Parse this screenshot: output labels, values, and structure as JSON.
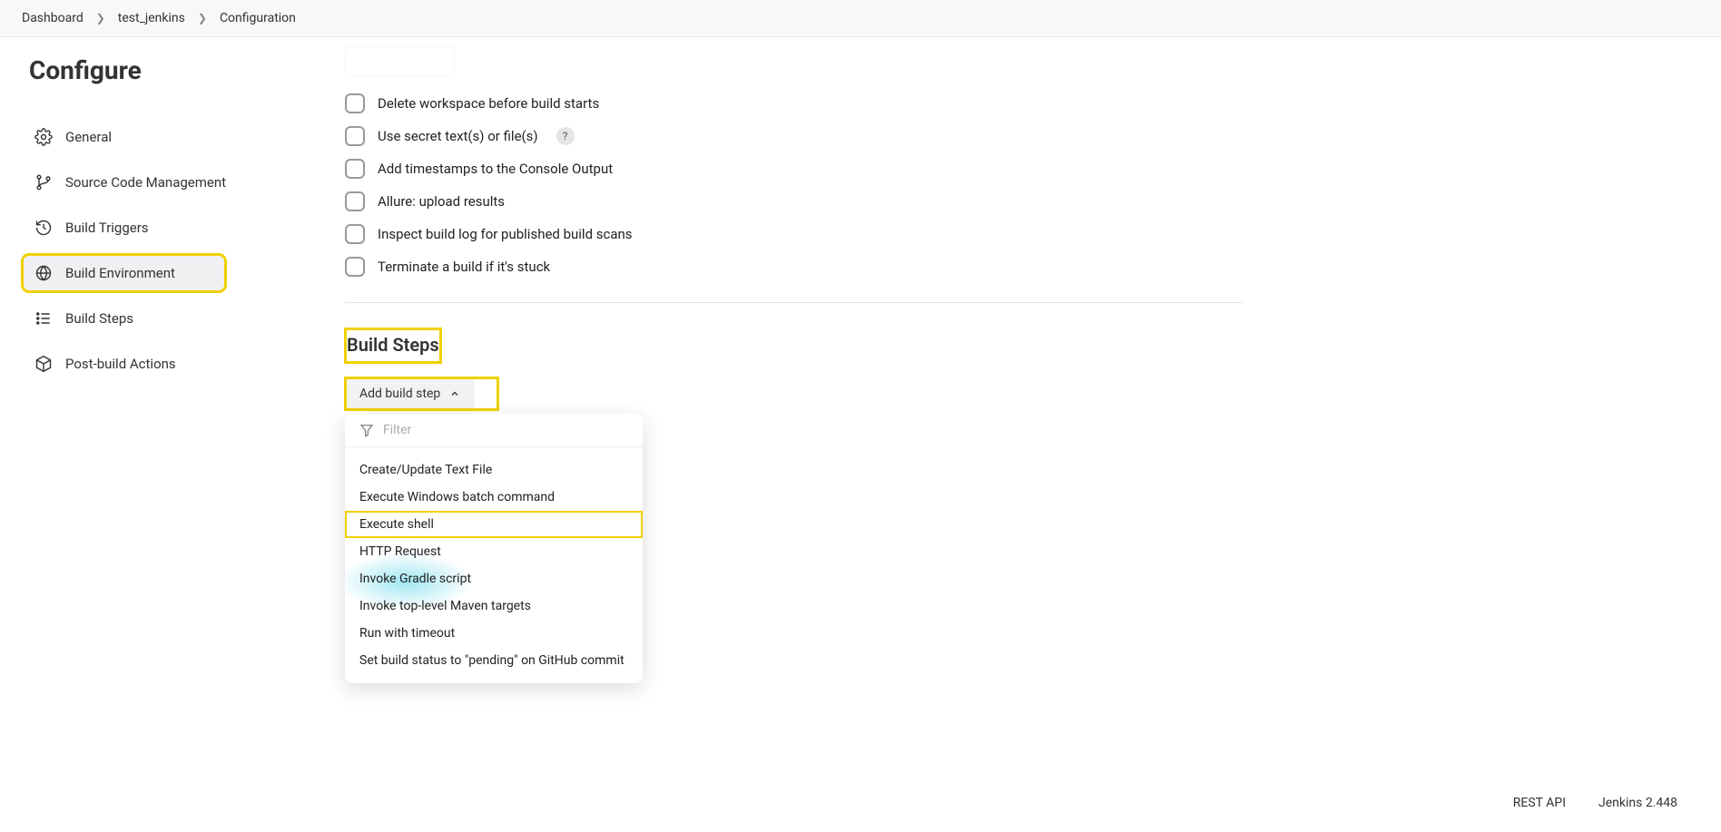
{
  "breadcrumb": {
    "items": [
      "Dashboard",
      "test_jenkins",
      "Configuration"
    ]
  },
  "sidebar": {
    "title": "Configure",
    "items": [
      {
        "label": "General"
      },
      {
        "label": "Source Code Management"
      },
      {
        "label": "Build Triggers"
      },
      {
        "label": "Build Environment"
      },
      {
        "label": "Build Steps"
      },
      {
        "label": "Post-build Actions"
      }
    ]
  },
  "build_env": {
    "checks": [
      {
        "label": "Delete workspace before build starts"
      },
      {
        "label": "Use secret text(s) or file(s)",
        "help": "?"
      },
      {
        "label": "Add timestamps to the Console Output"
      },
      {
        "label": "Allure: upload results"
      },
      {
        "label": "Inspect build log for published build scans"
      },
      {
        "label": "Terminate a build if it's stuck"
      }
    ]
  },
  "build_steps": {
    "title": "Build Steps",
    "add_label": "Add build step",
    "filter_placeholder": "Filter",
    "options": [
      "Create/Update Text File",
      "Execute Windows batch command",
      "Execute shell",
      "HTTP Request",
      "Invoke Gradle script",
      "Invoke top-level Maven targets",
      "Run with timeout",
      "Set build status to \"pending\" on GitHub commit"
    ]
  },
  "footer": {
    "rest": "REST API",
    "version": "Jenkins 2.448"
  }
}
